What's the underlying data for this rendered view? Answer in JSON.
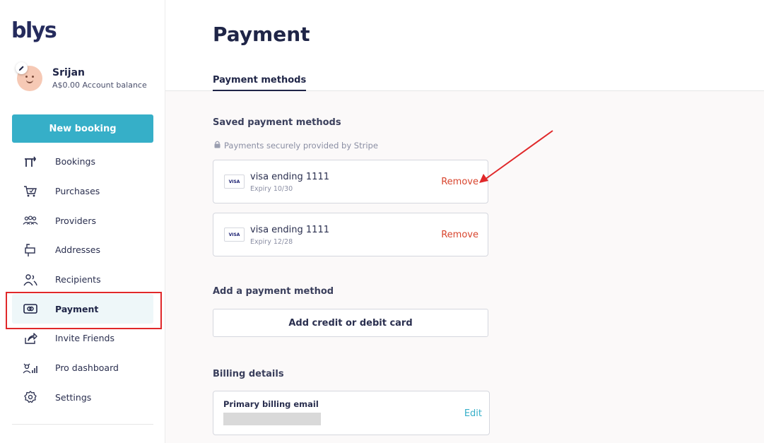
{
  "colors": {
    "accent": "#36afc8",
    "danger": "#d8452e",
    "navy": "#1f2547",
    "annotation": "#e0282a"
  },
  "brand": {
    "logo_text": "blys"
  },
  "profile": {
    "name": "Srijan",
    "balance": "A$0.00 Account balance"
  },
  "sidebar": {
    "new_booking_label": "New booking",
    "items": [
      {
        "label": "Bookings",
        "icon": "bookings-icon"
      },
      {
        "label": "Purchases",
        "icon": "cart-icon"
      },
      {
        "label": "Providers",
        "icon": "providers-icon"
      },
      {
        "label": "Addresses",
        "icon": "mailbox-icon"
      },
      {
        "label": "Recipients",
        "icon": "recipients-icon"
      },
      {
        "label": "Payment",
        "icon": "payment-icon",
        "active": true
      },
      {
        "label": "Invite Friends",
        "icon": "share-icon"
      },
      {
        "label": "Pro dashboard",
        "icon": "pro-dashboard-icon"
      },
      {
        "label": "Settings",
        "icon": "gear-icon"
      }
    ]
  },
  "main": {
    "title": "Payment",
    "tab_label": "Payment methods",
    "saved_title": "Saved payment methods",
    "stripe_note": "Payments securely provided by Stripe",
    "cards": [
      {
        "brand": "VISA",
        "title": "visa ending 1111",
        "expiry": "Expiry 10/30",
        "remove_label": "Remove"
      },
      {
        "brand": "VISA",
        "title": "visa ending 1111",
        "expiry": "Expiry 12/28",
        "remove_label": "Remove"
      }
    ],
    "add_title": "Add a payment method",
    "add_button_label": "Add credit or debit card",
    "billing_title": "Billing details",
    "billing_email_label": "Primary billing email",
    "billing_edit_label": "Edit"
  }
}
